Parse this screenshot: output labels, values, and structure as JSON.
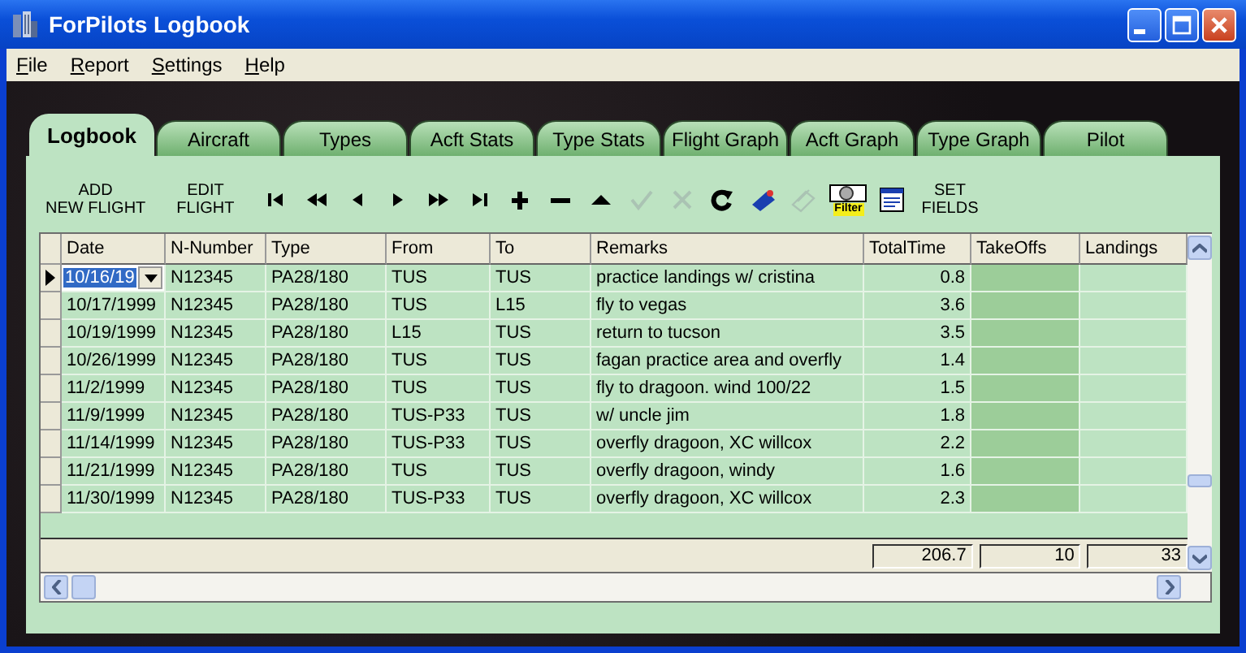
{
  "window": {
    "title": "ForPilots Logbook"
  },
  "menu": [
    "File",
    "Report",
    "Settings",
    "Help"
  ],
  "tabs": [
    {
      "label": "Logbook",
      "selected": true
    },
    {
      "label": "Aircraft",
      "selected": false
    },
    {
      "label": "Types",
      "selected": false
    },
    {
      "label": "Acft Stats",
      "selected": false
    },
    {
      "label": "Type Stats",
      "selected": false
    },
    {
      "label": "Flight Graph",
      "selected": false
    },
    {
      "label": "Acft Graph",
      "selected": false
    },
    {
      "label": "Type Graph",
      "selected": false
    },
    {
      "label": "Pilot",
      "selected": false
    }
  ],
  "toolbar": [
    {
      "kind": "text",
      "lines": [
        "ADD",
        "NEW FLIGHT"
      ]
    },
    {
      "kind": "text",
      "lines": [
        "EDIT",
        "FLIGHT"
      ]
    },
    {
      "kind": "first",
      "disabled": false
    },
    {
      "kind": "prev-page",
      "disabled": false
    },
    {
      "kind": "prev",
      "disabled": false
    },
    {
      "kind": "next",
      "disabled": false
    },
    {
      "kind": "next-page",
      "disabled": false
    },
    {
      "kind": "last",
      "disabled": false
    },
    {
      "kind": "plus",
      "disabled": false
    },
    {
      "kind": "minus",
      "disabled": false
    },
    {
      "kind": "up",
      "disabled": false
    },
    {
      "kind": "check",
      "disabled": true
    },
    {
      "kind": "cancel",
      "disabled": true
    },
    {
      "kind": "refresh",
      "disabled": false
    },
    {
      "kind": "tag",
      "disabled": false
    },
    {
      "kind": "tags",
      "disabled": true
    },
    {
      "kind": "filter",
      "label": "Filter"
    },
    {
      "kind": "list",
      "disabled": false
    },
    {
      "kind": "text",
      "lines": [
        "SET",
        "FIELDS"
      ]
    }
  ],
  "table": {
    "columns": [
      "Date",
      "N-Number",
      "Type",
      "From",
      "To",
      "Remarks",
      "TotalTime",
      "TakeOffs",
      "Landings"
    ],
    "rows": [
      {
        "selected": true,
        "cells": [
          "10/16/19",
          "N12345",
          "PA28/180",
          "TUS",
          "TUS",
          "practice landings w/ cristina",
          "0.8"
        ]
      },
      {
        "selected": false,
        "cells": [
          "10/17/1999",
          "N12345",
          "PA28/180",
          "TUS",
          "L15",
          "fly to vegas",
          "3.6"
        ]
      },
      {
        "selected": false,
        "cells": [
          "10/19/1999",
          "N12345",
          "PA28/180",
          "L15",
          "TUS",
          "return to tucson",
          "3.5"
        ]
      },
      {
        "selected": false,
        "cells": [
          "10/26/1999",
          "N12345",
          "PA28/180",
          "TUS",
          "TUS",
          "fagan practice area and overfly",
          "1.4"
        ]
      },
      {
        "selected": false,
        "cells": [
          "11/2/1999",
          "N12345",
          "PA28/180",
          "TUS",
          "TUS",
          "fly to dragoon. wind 100/22",
          "1.5"
        ]
      },
      {
        "selected": false,
        "cells": [
          "11/9/1999",
          "N12345",
          "PA28/180",
          "TUS-P33",
          "TUS",
          "w/ uncle jim",
          "1.8"
        ]
      },
      {
        "selected": false,
        "cells": [
          "11/14/1999",
          "N12345",
          "PA28/180",
          "TUS-P33",
          "TUS",
          "overfly dragoon, XC willcox",
          "2.2"
        ]
      },
      {
        "selected": false,
        "cells": [
          "11/21/1999",
          "N12345",
          "PA28/180",
          "TUS",
          "TUS",
          "overfly dragoon, windy",
          "1.6"
        ]
      },
      {
        "selected": false,
        "cells": [
          "11/30/1999",
          "N12345",
          "PA28/180",
          "TUS-P33",
          "TUS",
          "overfly dragoon, XC willcox",
          "2.3"
        ]
      }
    ],
    "totals": [
      "206.7",
      "10",
      "33"
    ]
  }
}
